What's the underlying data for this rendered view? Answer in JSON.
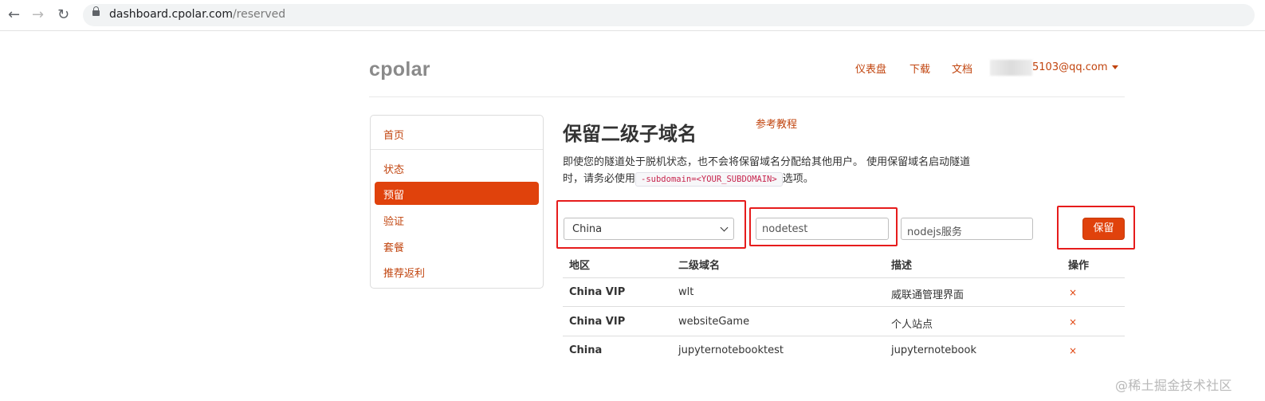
{
  "browser": {
    "url_host": "dashboard.cpolar.com",
    "url_path": "/reserved"
  },
  "header": {
    "brand": "cpolar",
    "nav": [
      "仪表盘",
      "下载",
      "文档"
    ],
    "account_email": "5103@qq.com"
  },
  "sidebar": {
    "items": [
      "首页",
      "状态",
      "预留",
      "验证",
      "套餐",
      "推荐返利"
    ],
    "active": "预留"
  },
  "main": {
    "title": "保留二级子域名",
    "tutorial_link": "参考教程",
    "description_part1": "即使您的隧道处于脱机状态，也不会将保留域名分配给其他用户。 使用保留域名启动隧道",
    "description_part2": "时，请务必使用",
    "description_code": "-subdomain=<YOUR_SUBDOMAIN>",
    "description_part3": "选项。"
  },
  "form": {
    "region_value": "China",
    "subdomain_value": "nodetest",
    "description_value": "nodejs服务",
    "submit_label": "保留"
  },
  "table": {
    "headers": [
      "地区",
      "二级域名",
      "描述",
      "操作"
    ],
    "rows": [
      {
        "region": "China VIP",
        "subdomain": "wlt",
        "description": "威联通管理界面",
        "action": "×"
      },
      {
        "region": "China VIP",
        "subdomain": "websiteGame",
        "description": "个人站点",
        "action": "×"
      },
      {
        "region": "China",
        "subdomain": "jupyternotebooktest",
        "description": "jupyternotebook",
        "action": "×"
      }
    ]
  },
  "watermark": "@稀土掘金技术社区",
  "colors": {
    "accent": "#e0420c",
    "link": "#c1440e",
    "highlight_box": "#e61c1c"
  }
}
